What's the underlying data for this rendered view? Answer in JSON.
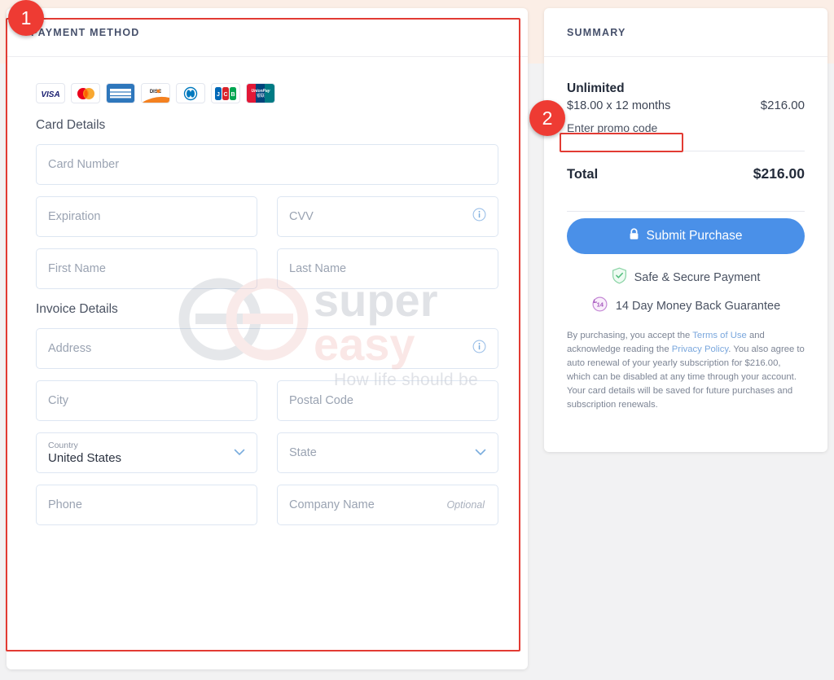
{
  "payment": {
    "header": "PAYMENT METHOD",
    "accepted_cards": [
      {
        "name": "visa-card-icon",
        "label": "VISA"
      },
      {
        "name": "mastercard-card-icon",
        "label": "Mastercard"
      },
      {
        "name": "amex-card-icon",
        "label": "AMERICAN EXPRESS"
      },
      {
        "name": "discover-card-icon",
        "label": "DISCOVER"
      },
      {
        "name": "diners-club-card-icon",
        "label": "Diners Club"
      },
      {
        "name": "jcb-card-icon",
        "label": "JCB"
      },
      {
        "name": "unionpay-card-icon",
        "label": "UnionPay"
      }
    ],
    "card_details_title": "Card Details",
    "invoice_details_title": "Invoice Details",
    "fields": {
      "card_number": "Card Number",
      "expiration": "Expiration",
      "cvv": "CVV",
      "first_name": "First Name",
      "last_name": "Last Name",
      "address": "Address",
      "city": "City",
      "postal_code": "Postal Code",
      "country_label": "Country",
      "country_value": "United States",
      "state": "State",
      "phone": "Phone",
      "company_name": "Company Name",
      "company_optional": "Optional"
    }
  },
  "summary": {
    "header": "SUMMARY",
    "plan_name": "Unlimited",
    "plan_terms": "$18.00 x 12 months",
    "plan_price": "$216.00",
    "promo_link": "Enter promo code",
    "total_label": "Total",
    "total_value": "$216.00",
    "submit_label": "Submit Purchase",
    "trust_secure": "Safe & Secure Payment",
    "trust_guarantee": "14 Day Money Back Guarantee",
    "guarantee_days": "14",
    "fineprint": {
      "p1_a": "By purchasing, you accept the ",
      "terms_link": "Terms of Use",
      "p1_b": " and acknowledge reading the ",
      "privacy_link": "Privacy Policy",
      "p1_c": ". You also agree to auto renewal of your yearly subscription for $216.00, which can be disabled at any time through your account.",
      "p2": "Your card details will be saved for future purchases and subscription renewals."
    }
  },
  "annotations": {
    "marker_1": "1",
    "marker_2": "2",
    "highlight_color": "#e23b33",
    "marker_color": "#ee3b33"
  },
  "watermark": {
    "word_1": "super",
    "word_2": "easy",
    "tagline": "How life should be"
  },
  "colors": {
    "accent_button": "#4a90e8",
    "header_text": "#46506b",
    "field_border": "#dde6f2",
    "page_bg": "#f2f2f3",
    "top_band": "#fbeee6"
  }
}
